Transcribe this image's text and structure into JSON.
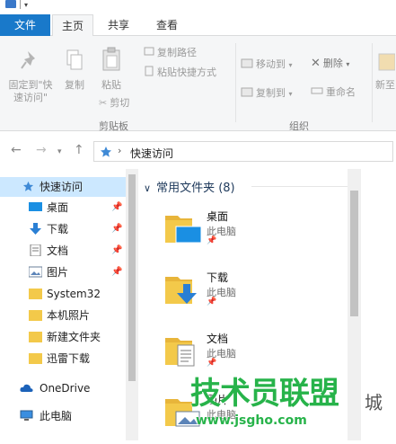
{
  "ribbon": {
    "tabs": [
      "文件",
      "主页",
      "共享",
      "查看"
    ],
    "active_tab": "主页",
    "clipboard": {
      "pin_label_1": "固定到\"快",
      "pin_label_2": "速访问\"",
      "copy_label": "复制",
      "paste_label": "粘贴",
      "copy_path_label": "复制路径",
      "paste_shortcut_label": "粘贴快捷方式",
      "cut_label": "剪切",
      "group_label": "剪贴板"
    },
    "organize": {
      "move_to_label": "移动到",
      "copy_to_label": "复制到",
      "delete_label": "删除",
      "rename_label": "重命名",
      "group_label": "组织"
    },
    "new": {
      "new_label_partial": "新至"
    }
  },
  "address": {
    "crumb": "快速访问"
  },
  "nav": {
    "items": [
      {
        "label": "快速访问",
        "icon": "star-icon",
        "pinned": false,
        "selected": true
      },
      {
        "label": "桌面",
        "icon": "desktop-icon",
        "pinned": true
      },
      {
        "label": "下载",
        "icon": "download-icon",
        "pinned": true
      },
      {
        "label": "文档",
        "icon": "document-icon",
        "pinned": true
      },
      {
        "label": "图片",
        "icon": "pictures-icon",
        "pinned": true
      },
      {
        "label": "System32",
        "icon": "folder-icon",
        "pinned": false
      },
      {
        "label": "本机照片",
        "icon": "folder-icon",
        "pinned": false
      },
      {
        "label": "新建文件夹",
        "icon": "folder-icon",
        "pinned": false
      },
      {
        "label": "迅雷下载",
        "icon": "folder-icon",
        "pinned": false
      },
      {
        "label": "OneDrive",
        "icon": "cloud-icon",
        "pinned": false
      },
      {
        "label": "此电脑",
        "icon": "computer-icon",
        "pinned": false
      }
    ]
  },
  "content": {
    "group_title": "常用文件夹 (8)",
    "folders": [
      {
        "name": "桌面",
        "location": "此电脑"
      },
      {
        "name": "下载",
        "location": "此电脑"
      },
      {
        "name": "文档",
        "location": "此电脑"
      },
      {
        "name": "图片",
        "location": "此电脑"
      }
    ]
  },
  "watermark": {
    "text": "技术员联盟",
    "url": "www.jsgho.com",
    "suffix": "城"
  },
  "colors": {
    "file_tab": "#1979ca",
    "selection": "#cce8ff",
    "group_header": "#1e395b",
    "folder_yellow": "#f3c94a",
    "watermark_green": "#27b34a"
  }
}
